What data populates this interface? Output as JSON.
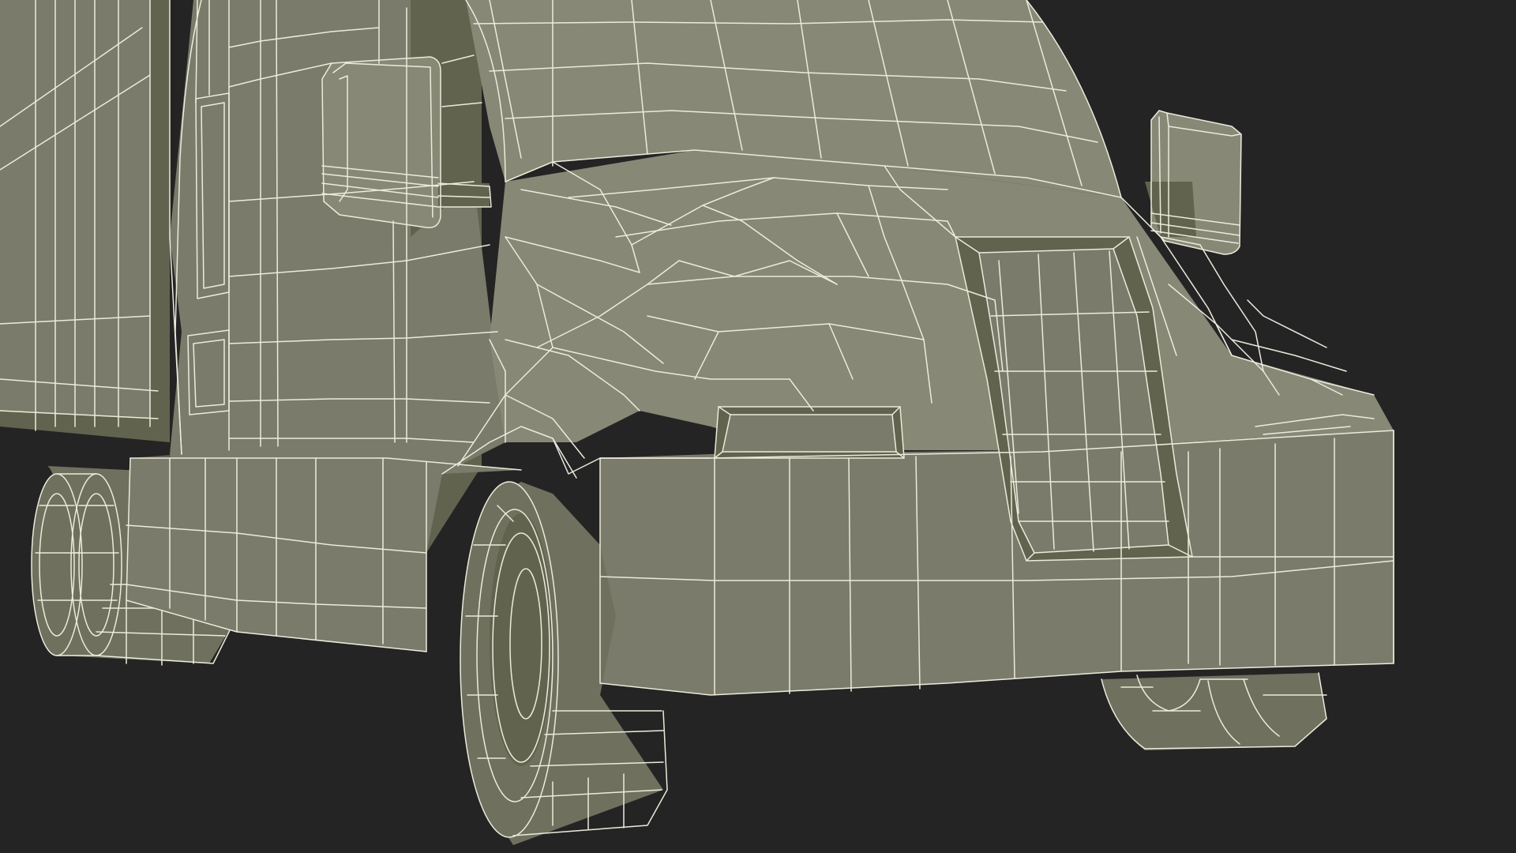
{
  "scene": {
    "subject": "semi-truck-wireframe",
    "colors": {
      "background": "#242424",
      "surface": "#7a7b6a",
      "surface_light": "#878876",
      "surface_dark": "#62634f",
      "wire": "#ecebdc",
      "tire": "#6f705e"
    }
  }
}
